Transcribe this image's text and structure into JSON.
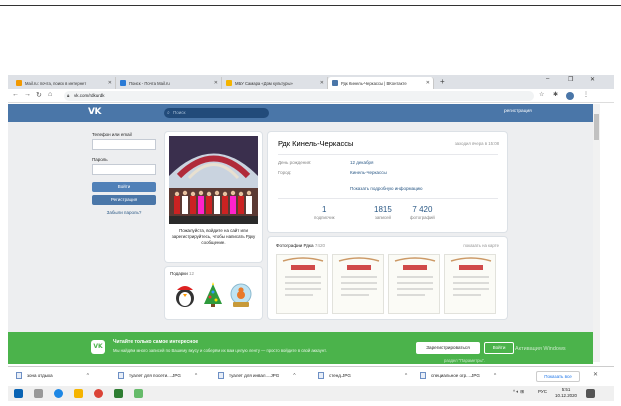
{
  "browser": {
    "tabs": [
      {
        "label": "Mail.ru: почта, поиск в интернет",
        "favicon_color": "#f29900"
      },
      {
        "label": "Поиск - Почта Mail.ru",
        "favicon_color": "#2b7bd6"
      },
      {
        "label": "МБУ Самара «Дом культуры»",
        "favicon_color": "#f4b400"
      },
      {
        "label": "Рдк Кинель-Черкассы | ВКонтакте",
        "favicon_color": "#4a76a8"
      }
    ],
    "new_tab": "+",
    "url": "vk.com/rdkurdk",
    "window_controls": [
      "–",
      "❐",
      "✕"
    ]
  },
  "vk": {
    "logo": "VK",
    "search_placeholder": "Поиск",
    "header_register": "регистрация",
    "login": {
      "phone_label": "Телефон или email",
      "password_label": "Пароль",
      "login_button": "Войти",
      "register_button": "Регистрация",
      "forgot": "Забыли пароль?"
    },
    "photo_caption": "Пожалуйста, войдите на сайт или зарегистрируйтесь, чтобы написать Рдку сообщение.",
    "gifts": {
      "title": "Подарки",
      "count": "12"
    },
    "profile": {
      "name": "Рдк Кинель-Черкассы",
      "last_seen": "заходил вчера в 15:08",
      "birthday_label": "День рождения:",
      "birthday_value": "12 декабря",
      "city_label": "Город:",
      "city_value": "Кинель-Черкассы",
      "more_info": "Показать подробную информацию",
      "counters": [
        {
          "value": "1",
          "label": "подписчик"
        },
        {
          "value": "1815",
          "label": "записей"
        },
        {
          "value": "7 420",
          "label": "фотографий"
        }
      ]
    },
    "photos": {
      "title": "Фотографии Рдка",
      "count": "7420",
      "map_link": "показать на карте"
    },
    "banner": {
      "title": "Читайте только самое интересное",
      "text": "Мы найдём много записей по Вашему вкусу и соберём их вам целую ленту — просто войдите в свой аккаунт.",
      "register_button": "Зарегистрироваться",
      "login_button": "Войти"
    }
  },
  "downloads": {
    "items": [
      "зона отдыха",
      "туалет для посети....JPG",
      "туалет для инвал....JPG",
      "стенд.JPG",
      "специальное огр....JPG"
    ],
    "show_all": "Показать все"
  },
  "taskbar": {
    "lang": "РУС",
    "time": "5:51",
    "date": "10.12.2020"
  },
  "watermark": {
    "activate": "Активация Windows",
    "hint": "раздел \"Параметры\"."
  }
}
